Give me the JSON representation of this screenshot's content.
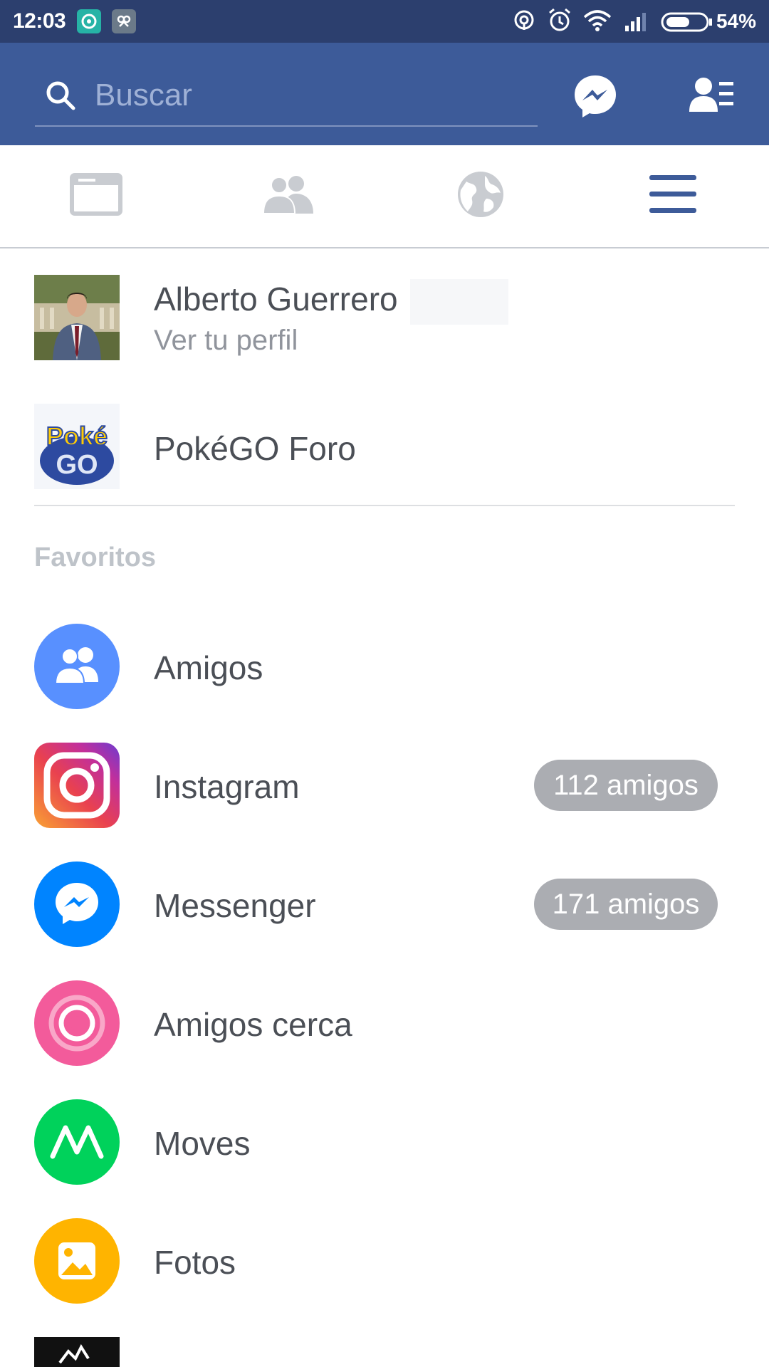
{
  "status_bar": {
    "time": "12:03",
    "battery_percent": "54%"
  },
  "search": {
    "placeholder": "Buscar"
  },
  "header_icons": [
    "messenger-icon",
    "friend-requests-icon"
  ],
  "nav_tabs": [
    {
      "icon": "news-feed-icon",
      "active": false
    },
    {
      "icon": "friends-icon",
      "active": false
    },
    {
      "icon": "globe-icon",
      "active": false
    },
    {
      "icon": "menu-icon",
      "active": true
    }
  ],
  "profile": {
    "name": "Alberto Guerrero",
    "subtitle": "Ver tu perfil"
  },
  "page": {
    "name": "PokéGO Foro",
    "logo_text_top": "Poké",
    "logo_text_bottom": "GO"
  },
  "favorites": {
    "label": "Favoritos",
    "items": [
      {
        "label": "Amigos",
        "icon": "friends-circle-icon",
        "color": "#5890ff",
        "badge": ""
      },
      {
        "label": "Instagram",
        "icon": "instagram-icon",
        "color": "#d6249f",
        "badge": "112 amigos"
      },
      {
        "label": "Messenger",
        "icon": "messenger-circle-icon",
        "color": "#0084ff",
        "badge": "171 amigos"
      },
      {
        "label": "Amigos cerca",
        "icon": "nearby-friends-icon",
        "color": "#f35b9b",
        "badge": ""
      },
      {
        "label": "Moves",
        "icon": "moves-icon",
        "color": "#00d25b",
        "badge": ""
      },
      {
        "label": "Fotos",
        "icon": "photos-icon",
        "color": "#ffb400",
        "badge": ""
      }
    ]
  },
  "colors": {
    "header": "#3d5b99",
    "status_bar": "#2c3f6e",
    "active_tab": "#3d5b99",
    "inactive_tab": "#c9ccd1",
    "badge": "#abadb2"
  }
}
